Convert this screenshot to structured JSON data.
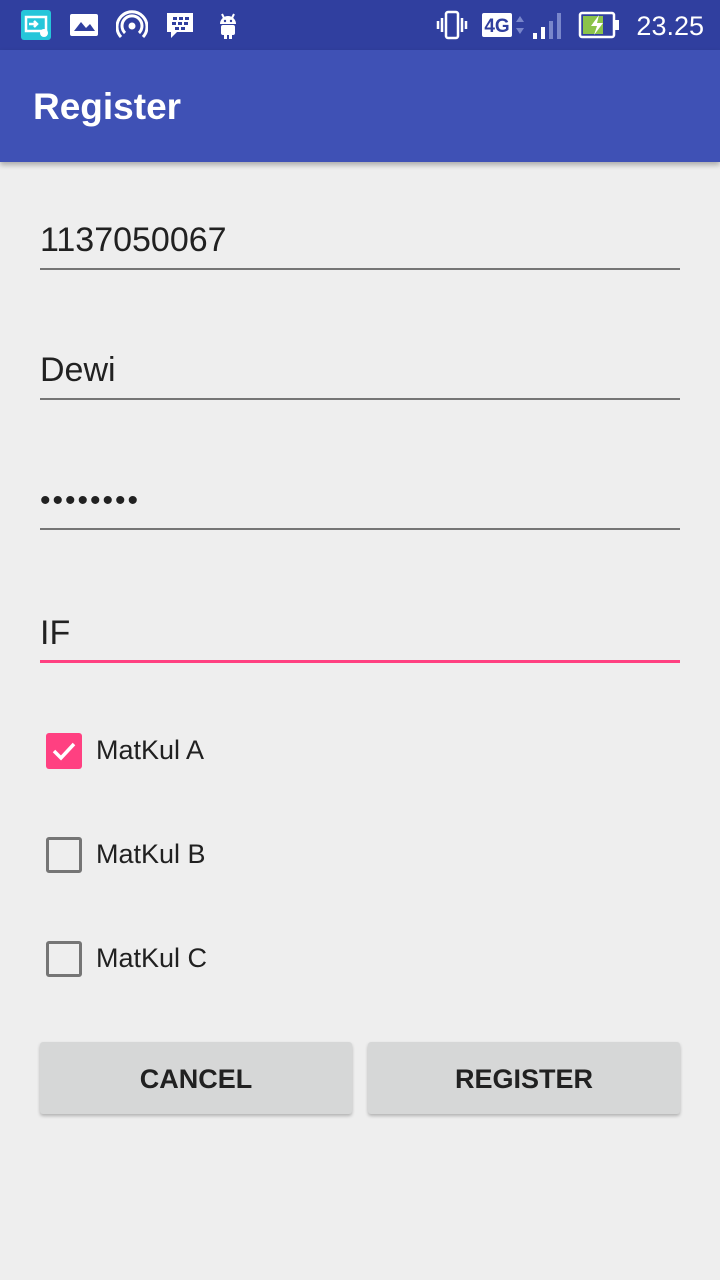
{
  "status_bar": {
    "time": "23.25",
    "network": "4G",
    "icons": [
      "screen-cast-icon",
      "image-icon",
      "hotspot-icon",
      "bbm-icon",
      "android-icon",
      "vibrate-icon",
      "network-4g-icon",
      "signal-icon",
      "battery-charging-icon"
    ]
  },
  "app_bar": {
    "title": "Register"
  },
  "form": {
    "nim": "1137050067",
    "name": "Dewi",
    "password_masked": "••••••••",
    "major": "IF"
  },
  "checkboxes": [
    {
      "label": "MatKul A",
      "checked": true
    },
    {
      "label": "MatKul B",
      "checked": false
    },
    {
      "label": "MatKul C",
      "checked": false
    }
  ],
  "buttons": {
    "cancel": "CANCEL",
    "register": "REGISTER"
  },
  "colors": {
    "primary": "#3f51b5",
    "primary_dark": "#303f9f",
    "accent": "#ff4081",
    "background": "#eeeeee"
  }
}
